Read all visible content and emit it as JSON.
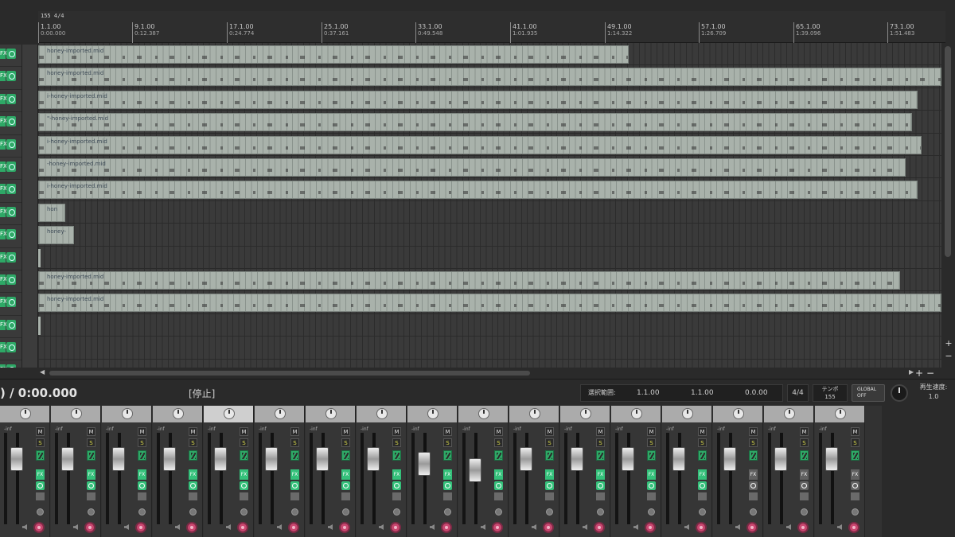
{
  "ruler": {
    "tempo_marker": "155 4/4",
    "marks": [
      {
        "bar": "1.1.00",
        "time": "0:00.000"
      },
      {
        "bar": "9.1.00",
        "time": "0:12.387"
      },
      {
        "bar": "17.1.00",
        "time": "0:24.774"
      },
      {
        "bar": "25.1.00",
        "time": "0:37.161"
      },
      {
        "bar": "33.1.00",
        "time": "0:49.548"
      },
      {
        "bar": "41.1.00",
        "time": "1:01.935"
      },
      {
        "bar": "49.1.00",
        "time": "1:14.322"
      },
      {
        "bar": "57.1.00",
        "time": "1:26.709"
      },
      {
        "bar": "65.1.00",
        "time": "1:39.096"
      },
      {
        "bar": "73.1.00",
        "time": "1:51.483"
      }
    ]
  },
  "tracks": [
    {
      "fx": "FX",
      "item_name": "honey-imported.mid"
    },
    {
      "fx": "FX",
      "item_name": "honey-imported.mid"
    },
    {
      "fx": "FX",
      "item_name": "i-honey-imported.mid"
    },
    {
      "fx": "FX",
      "item_name": "\"-honey-imported.mid"
    },
    {
      "fx": "FX",
      "item_name": "i-honey-imported.mid"
    },
    {
      "fx": "FX",
      "item_name": "-honey-imported.mid"
    },
    {
      "fx": "FX",
      "item_name": "i-honey-imported.mid"
    },
    {
      "fx": "FX",
      "item_name": "hon"
    },
    {
      "fx": "FX",
      "item_name": "honey-"
    },
    {
      "fx": "FX",
      "item_name": ""
    },
    {
      "fx": "FX",
      "item_name": "honey-imported.mid"
    },
    {
      "fx": "FX",
      "item_name": "honey-imported.mid"
    },
    {
      "fx": "FX",
      "item_name": ""
    },
    {
      "fx": "FX",
      "item_name": ""
    },
    {
      "fx": "FX",
      "item_name": ""
    }
  ],
  "transport": {
    "time": ") / 0:00.000",
    "state": "[停止]",
    "selection_label": "選択範囲:",
    "selection_start": "1.1.00",
    "selection_end": "1.1.00",
    "selection_length": "0.0.00",
    "time_signature": "4/4",
    "tempo_label": "テンポ",
    "tempo_value": "155",
    "global_label": "GLOBAL",
    "global_state": "OFF",
    "rate_label": "再生速度:",
    "rate_value": "1.0"
  },
  "mixer": {
    "vol_label": "-inf",
    "mute_label": "M",
    "solo_label": "S",
    "fx_label": "FX",
    "strips": [
      {
        "fx_on": true
      },
      {
        "fx_on": true
      },
      {
        "fx_on": true
      },
      {
        "fx_on": true
      },
      {
        "fx_on": true,
        "selected": true
      },
      {
        "fx_on": true
      },
      {
        "fx_on": true
      },
      {
        "fx_on": true
      },
      {
        "fx_on": true
      },
      {
        "fx_on": true
      },
      {
        "fx_on": true
      },
      {
        "fx_on": true
      },
      {
        "fx_on": true
      },
      {
        "fx_on": true
      },
      {
        "fx_on": false
      },
      {
        "fx_on": false
      },
      {
        "fx_on": false
      }
    ]
  },
  "colors": {
    "item": "#a9b2ab",
    "arm": "#2ea866",
    "record": "#c9466f"
  }
}
